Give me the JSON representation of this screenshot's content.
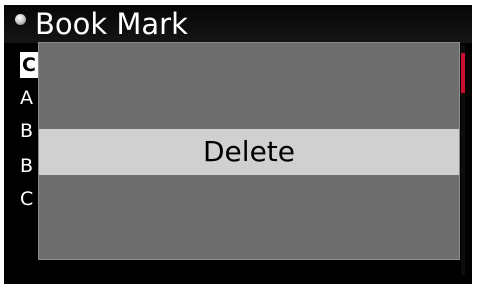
{
  "header": {
    "title": "Book Mark",
    "icon": "disc-icon"
  },
  "list": {
    "items": [
      {
        "label": "C",
        "selected": true
      },
      {
        "label": "A"
      },
      {
        "label": "B"
      },
      {
        "label": "B"
      },
      {
        "label": "C"
      }
    ]
  },
  "popup": {
    "option_label": "Delete"
  },
  "colors": {
    "screen_background": "#000000",
    "popup_background": "#6e6e6e",
    "popup_highlight": "#d0d0d0",
    "scroll_thumb": "#c8102e"
  }
}
